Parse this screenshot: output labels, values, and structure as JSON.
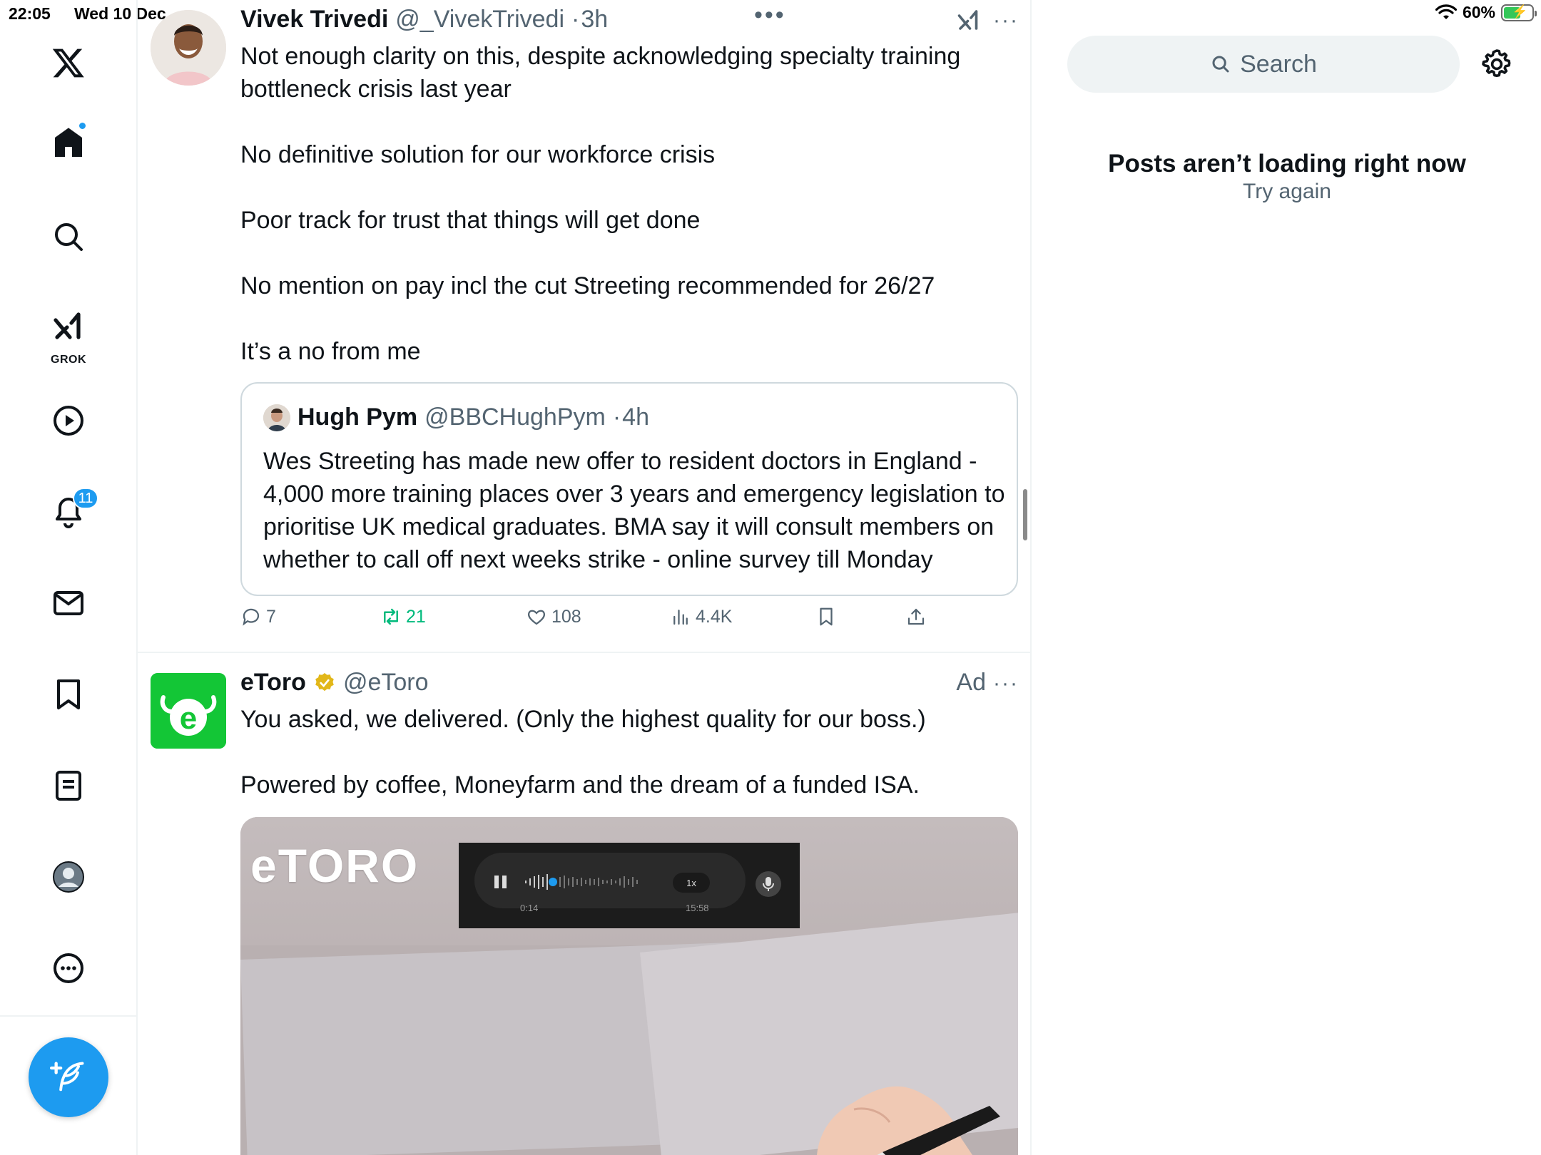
{
  "status_bar": {
    "time": "22:05",
    "date": "Wed 10 Dec",
    "battery": "60%",
    "battery_level": 0.6
  },
  "nav": {
    "items": [
      {
        "name": "x-logo-icon"
      },
      {
        "name": "home-icon",
        "has_dot": true
      },
      {
        "name": "search-icon"
      },
      {
        "name": "grok-icon",
        "label": "GROK"
      },
      {
        "name": "video-icon"
      },
      {
        "name": "notifications-icon",
        "badge": "11"
      },
      {
        "name": "messages-icon"
      },
      {
        "name": "bookmarks-icon"
      },
      {
        "name": "lists-icon"
      },
      {
        "name": "profile-icon"
      },
      {
        "name": "more-icon"
      }
    ],
    "compose_icon": "feather-plus-icon",
    "accent": "#1d9bf0"
  },
  "timeline": {
    "post1": {
      "name": "Vivek Trivedi",
      "handle": "@_VivekTrivedi",
      "time": "3h",
      "lines": [
        "Not enough clarity on this, despite acknowledging specialty training bottleneck crisis last year",
        "No definitive solution for our workforce crisis",
        "Poor track for trust that things will get done",
        "No mention on pay incl the cut Streeting recommended for 26/27",
        "It’s a no from me"
      ],
      "quote": {
        "name": "Hugh Pym",
        "handle": "@BBCHughPym",
        "time": "4h",
        "text": "Wes Streeting has made new offer to resident doctors in England - 4,000 more training places over 3 years and emergency legislation to prioritise UK medical graduates. BMA say it will consult members on whether to call off next weeks strike - online survey till Monday"
      },
      "actions": {
        "replies": "7",
        "reposts": "21",
        "likes": "108",
        "views": "4.4K"
      }
    },
    "post2": {
      "name": "eToro",
      "handle": "@eToro",
      "ad_label": "Ad",
      "lines": [
        "You asked, we delivered. (Only the highest quality for our boss.)",
        "Powered by coffee, Moneyfarm and the dream of a funded ISA."
      ],
      "media": {
        "watermark": "eTORO",
        "player": {
          "speed": "1x",
          "elapsed": "0:14",
          "total": "15:58"
        }
      },
      "brand_color": "#13c636"
    }
  },
  "right": {
    "search_placeholder": "Search",
    "error_title": "Posts aren’t loading right now",
    "retry_label": "Try again"
  }
}
